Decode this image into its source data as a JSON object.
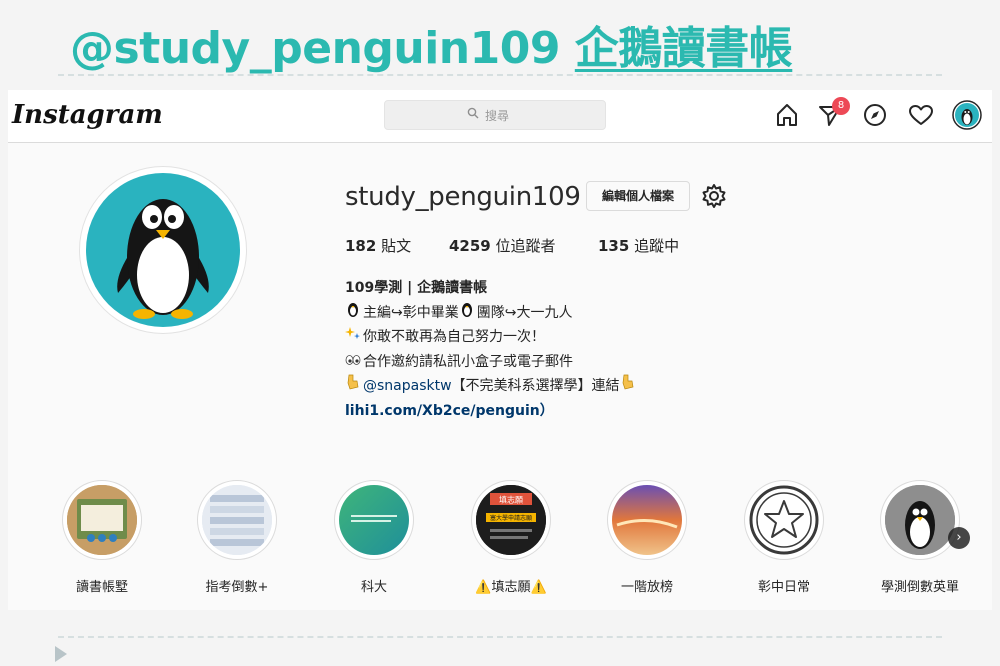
{
  "slide": {
    "title_handle": "@study_penguin109",
    "title_zh": "企鵝讀書帳"
  },
  "topbar": {
    "logo": "Instagram",
    "search_placeholder": "搜尋",
    "direct_badge": "8",
    "icons": [
      "home-icon",
      "direct-icon",
      "explore-icon",
      "heart-icon",
      "profile-avatar-icon"
    ]
  },
  "profile": {
    "username": "study_penguin109",
    "edit_button": "編輯個人檔案",
    "stats": {
      "posts_count": "182",
      "posts_label": "貼文",
      "followers_count": "4259",
      "followers_label": "位追蹤者",
      "following_count": "135",
      "following_label": "追蹤中"
    },
    "bio": {
      "name": "109學測 | 企鵝讀書帳",
      "line1": "主編↪彰中畢業",
      "line1b": "團隊↪大一九人",
      "line2": "你敢不敢再為自己努力一次！",
      "line3": "合作邀約請私訊小盒子或電子郵件",
      "line4_mention": "@snapasktw",
      "line4_rest": "【不完美科系選擇學】連結",
      "link": "lihi1.com/Xb2ce/penguin",
      "link_suffix": "）"
    }
  },
  "highlights": [
    {
      "label": "讀書帳墅"
    },
    {
      "label": "指考倒數+"
    },
    {
      "label": "科大"
    },
    {
      "label": "⚠️填志願⚠️"
    },
    {
      "label": "一階放榜"
    },
    {
      "label": "彰中日常"
    },
    {
      "label": "學測倒數英單"
    }
  ],
  "highlight_thumb_texts": {
    "fill_card_head": "填志願",
    "fill_card_body": "塞大學申請志願"
  },
  "colors": {
    "title_teal": "#2bb9b0",
    "avatar_bg": "#2ab3bf",
    "badge_red": "#ed4956",
    "link_blue": "#00376b"
  }
}
